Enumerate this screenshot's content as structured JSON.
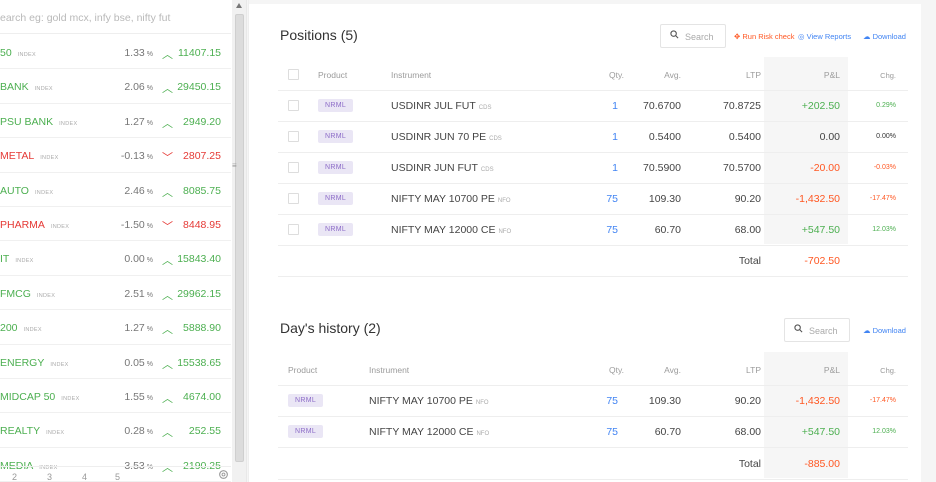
{
  "watchlist": {
    "search_placeholder": "earch eg: gold mcx, infy bse, nifty fut",
    "items": [
      {
        "name": "50",
        "tag": "INDEX",
        "pct": "1.33",
        "dir": "up",
        "price": "11407.15"
      },
      {
        "name": "BANK",
        "tag": "INDEX",
        "pct": "2.06",
        "dir": "up",
        "price": "29450.15"
      },
      {
        "name": "PSU BANK",
        "tag": "INDEX",
        "pct": "1.27",
        "dir": "up",
        "price": "2949.20"
      },
      {
        "name": "METAL",
        "tag": "INDEX",
        "pct": "-0.13",
        "dir": "down",
        "price": "2807.25"
      },
      {
        "name": "AUTO",
        "tag": "INDEX",
        "pct": "2.46",
        "dir": "up",
        "price": "8085.75"
      },
      {
        "name": "PHARMA",
        "tag": "INDEX",
        "pct": "-1.50",
        "dir": "down",
        "price": "8448.95"
      },
      {
        "name": "IT",
        "tag": "INDEX",
        "pct": "0.00",
        "dir": "up",
        "price": "15843.40"
      },
      {
        "name": "FMCG",
        "tag": "INDEX",
        "pct": "2.51",
        "dir": "up",
        "price": "29962.15"
      },
      {
        "name": "200",
        "tag": "INDEX",
        "pct": "1.27",
        "dir": "up",
        "price": "5888.90"
      },
      {
        "name": "ENERGY",
        "tag": "INDEX",
        "pct": "0.05",
        "dir": "up",
        "price": "15538.65"
      },
      {
        "name": "MIDCAP 50",
        "tag": "INDEX",
        "pct": "1.55",
        "dir": "up",
        "price": "4674.00"
      },
      {
        "name": "REALTY",
        "tag": "INDEX",
        "pct": "0.28",
        "dir": "up",
        "price": "252.55"
      },
      {
        "name": "MEDIA",
        "tag": "INDEX",
        "pct": "3.53",
        "dir": "up",
        "price": "2190.25"
      }
    ],
    "pct_unit": "%",
    "pages": [
      "2",
      "3",
      "4",
      "5"
    ],
    "settings_icon": "gear-icon"
  },
  "positions": {
    "title": "Positions (5)",
    "search_placeholder": "Search",
    "run_risk_label": "Run Risk check",
    "view_reports_label": "View Reports",
    "download_label": "Download",
    "columns": [
      "Product",
      "Instrument",
      "Qty.",
      "Avg.",
      "LTP",
      "P&L",
      "Chg."
    ],
    "rows": [
      {
        "product": "NRML",
        "instrument": "USDINR JUL FUT",
        "exchange": "CDS",
        "qty": "1",
        "avg": "70.6700",
        "ltp": "70.8725",
        "pnl": "+202.50",
        "pnl_sign": "pos",
        "chg": "0.29%",
        "chg_sign": "pos"
      },
      {
        "product": "NRML",
        "instrument": "USDINR JUN 70 PE",
        "exchange": "CDS",
        "qty": "1",
        "avg": "0.5400",
        "ltp": "0.5400",
        "pnl": "0.00",
        "pnl_sign": "zero",
        "chg": "0.00%",
        "chg_sign": "zero"
      },
      {
        "product": "NRML",
        "instrument": "USDINR JUN FUT",
        "exchange": "CDS",
        "qty": "1",
        "avg": "70.5900",
        "ltp": "70.5700",
        "pnl": "-20.00",
        "pnl_sign": "neg",
        "chg": "-0.03%",
        "chg_sign": "neg"
      },
      {
        "product": "NRML",
        "instrument": "NIFTY MAY 10700 PE",
        "exchange": "NFO",
        "qty": "75",
        "avg": "109.30",
        "ltp": "90.20",
        "pnl": "-1,432.50",
        "pnl_sign": "neg",
        "chg": "-17.47%",
        "chg_sign": "neg"
      },
      {
        "product": "NRML",
        "instrument": "NIFTY MAY 12000 CE",
        "exchange": "NFO",
        "qty": "75",
        "avg": "60.70",
        "ltp": "68.00",
        "pnl": "+547.50",
        "pnl_sign": "pos",
        "chg": "12.03%",
        "chg_sign": "pos"
      }
    ],
    "total_label": "Total",
    "total_value": "-702.50"
  },
  "history": {
    "title": "Day's history (2)",
    "search_placeholder": "Search",
    "download_label": "Download",
    "columns": [
      "Product",
      "Instrument",
      "Qty.",
      "Avg.",
      "LTP",
      "P&L",
      "Chg."
    ],
    "rows": [
      {
        "product": "NRML",
        "instrument": "NIFTY MAY 10700 PE",
        "exchange": "NFO",
        "qty": "75",
        "avg": "109.30",
        "ltp": "90.20",
        "pnl": "-1,432.50",
        "pnl_sign": "neg",
        "chg": "-17.47%",
        "chg_sign": "neg"
      },
      {
        "product": "NRML",
        "instrument": "NIFTY MAY 12000 CE",
        "exchange": "NFO",
        "qty": "75",
        "avg": "60.70",
        "ltp": "68.00",
        "pnl": "+547.50",
        "pnl_sign": "pos",
        "chg": "12.03%",
        "chg_sign": "pos"
      }
    ],
    "total_label": "Total",
    "total_value": "-885.00"
  },
  "colors": {
    "up": "#4caf50",
    "down": "#e53935",
    "loss": "#ff5722",
    "accent": "#4184f3",
    "badge_bg": "#eae6f5",
    "badge_fg": "#8b6ac7"
  }
}
